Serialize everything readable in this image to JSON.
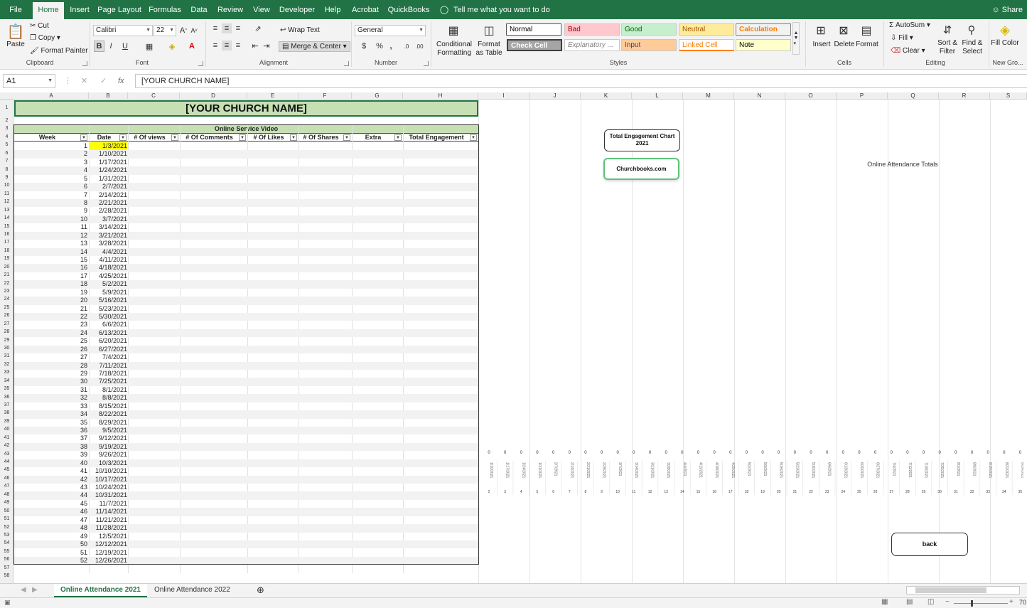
{
  "menu": {
    "tabs": [
      "File",
      "Home",
      "Insert",
      "Page Layout",
      "Formulas",
      "Data",
      "Review",
      "View",
      "Developer",
      "Help",
      "Acrobat",
      "QuickBooks"
    ],
    "active_tab": "Home",
    "tell_me": "Tell me what you want to do",
    "share": "Share"
  },
  "ribbon": {
    "clipboard": {
      "paste": "Paste",
      "cut": "Cut",
      "copy": "Copy",
      "format_painter": "Format Painter",
      "label": "Clipboard"
    },
    "font": {
      "name": "Calibri",
      "size": "22",
      "label": "Font"
    },
    "alignment": {
      "wrap": "Wrap Text",
      "merge": "Merge & Center",
      "label": "Alignment"
    },
    "number": {
      "format": "General",
      "currency": "$",
      "percent": "%",
      "comma": ",",
      "label": "Number"
    },
    "styles": {
      "conditional": "Conditional Formatting",
      "format_as_table": "Format as Table",
      "cells": [
        {
          "name": "Normal",
          "bg": "#ffffff",
          "fg": "#000000"
        },
        {
          "name": "Bad",
          "bg": "#ffc7ce",
          "fg": "#9c0006"
        },
        {
          "name": "Good",
          "bg": "#c6efce",
          "fg": "#006100"
        },
        {
          "name": "Neutral",
          "bg": "#ffeb9c",
          "fg": "#9c5700"
        },
        {
          "name": "Calculation",
          "bg": "#f2f2f2",
          "fg": "#fa7d00"
        },
        {
          "name": "Check Cell",
          "bg": "#a5a5a5",
          "fg": "#ffffff"
        },
        {
          "name": "Explanatory ...",
          "bg": "#ffffff",
          "fg": "#7f7f7f"
        },
        {
          "name": "Input",
          "bg": "#ffcc99",
          "fg": "#3f3f76"
        },
        {
          "name": "Linked Cell",
          "bg": "#ffffff",
          "fg": "#fa7d00"
        },
        {
          "name": "Note",
          "bg": "#ffffcc",
          "fg": "#000000"
        }
      ],
      "label": "Styles"
    },
    "cells": {
      "insert": "Insert",
      "delete": "Delete",
      "format": "Format",
      "label": "Cells"
    },
    "editing": {
      "autosum": "AutoSum",
      "fill": "Fill",
      "clear": "Clear",
      "sort": "Sort & Filter",
      "find": "Find & Select",
      "label": "Editing"
    },
    "newgroup": {
      "fill_color": "Fill Color",
      "label": "New Gro..."
    }
  },
  "formula_bar": {
    "name_box": "A1",
    "content": "[YOUR CHURCH NAME]"
  },
  "columns": [
    "A",
    "B",
    "C",
    "D",
    "E",
    "F",
    "G",
    "H",
    "I",
    "J",
    "K",
    "L",
    "M",
    "N",
    "O",
    "P",
    "Q",
    "R",
    "S"
  ],
  "sheet": {
    "title": "[YOUR CHURCH NAME]",
    "subtitle": "Online Service Video",
    "headers": [
      "Week",
      "Date",
      "# Of views",
      "# Of Comments",
      "# Of Likes",
      "# Of Shares",
      "Extra",
      "Total Engagement"
    ],
    "rows": [
      {
        "week": "1",
        "date": "1/3/2021"
      },
      {
        "week": "2",
        "date": "1/10/2021"
      },
      {
        "week": "3",
        "date": "1/17/2021"
      },
      {
        "week": "4",
        "date": "1/24/2021"
      },
      {
        "week": "5",
        "date": "1/31/2021"
      },
      {
        "week": "6",
        "date": "2/7/2021"
      },
      {
        "week": "7",
        "date": "2/14/2021"
      },
      {
        "week": "8",
        "date": "2/21/2021"
      },
      {
        "week": "9",
        "date": "2/28/2021"
      },
      {
        "week": "10",
        "date": "3/7/2021"
      },
      {
        "week": "11",
        "date": "3/14/2021"
      },
      {
        "week": "12",
        "date": "3/21/2021"
      },
      {
        "week": "13",
        "date": "3/28/2021"
      },
      {
        "week": "14",
        "date": "4/4/2021"
      },
      {
        "week": "15",
        "date": "4/11/2021"
      },
      {
        "week": "16",
        "date": "4/18/2021"
      },
      {
        "week": "17",
        "date": "4/25/2021"
      },
      {
        "week": "18",
        "date": "5/2/2021"
      },
      {
        "week": "19",
        "date": "5/9/2021"
      },
      {
        "week": "20",
        "date": "5/16/2021"
      },
      {
        "week": "21",
        "date": "5/23/2021"
      },
      {
        "week": "22",
        "date": "5/30/2021"
      },
      {
        "week": "23",
        "date": "6/6/2021"
      },
      {
        "week": "24",
        "date": "6/13/2021"
      },
      {
        "week": "25",
        "date": "6/20/2021"
      },
      {
        "week": "26",
        "date": "6/27/2021"
      },
      {
        "week": "27",
        "date": "7/4/2021"
      },
      {
        "week": "28",
        "date": "7/11/2021"
      },
      {
        "week": "29",
        "date": "7/18/2021"
      },
      {
        "week": "30",
        "date": "7/25/2021"
      },
      {
        "week": "31",
        "date": "8/1/2021"
      },
      {
        "week": "32",
        "date": "8/8/2021"
      },
      {
        "week": "33",
        "date": "8/15/2021"
      },
      {
        "week": "34",
        "date": "8/22/2021"
      },
      {
        "week": "35",
        "date": "8/29/2021"
      },
      {
        "week": "36",
        "date": "9/5/2021"
      },
      {
        "week": "37",
        "date": "9/12/2021"
      },
      {
        "week": "38",
        "date": "9/19/2021"
      },
      {
        "week": "39",
        "date": "9/26/2021"
      },
      {
        "week": "40",
        "date": "10/3/2021"
      },
      {
        "week": "41",
        "date": "10/10/2021"
      },
      {
        "week": "42",
        "date": "10/17/2021"
      },
      {
        "week": "43",
        "date": "10/24/2021"
      },
      {
        "week": "44",
        "date": "10/31/2021"
      },
      {
        "week": "45",
        "date": "11/7/2021"
      },
      {
        "week": "46",
        "date": "11/14/2021"
      },
      {
        "week": "47",
        "date": "11/21/2021"
      },
      {
        "week": "48",
        "date": "11/28/2021"
      },
      {
        "week": "49",
        "date": "12/5/2021"
      },
      {
        "week": "50",
        "date": "12/12/2021"
      },
      {
        "week": "51",
        "date": "12/19/2021"
      },
      {
        "week": "52",
        "date": "12/26/2021"
      }
    ]
  },
  "shapes": {
    "chart_title": "Total Engagement Chart 2021",
    "churchbooks": "Churchbooks.com",
    "back": "back",
    "chart_caption": "Online Attendance Totals"
  },
  "chart_data": {
    "type": "bar",
    "title": "Online Attendance Totals",
    "categories": [
      "1/10/2021",
      "1/17/2021",
      "1/24/2021",
      "1/31/2021",
      "2/7/2021",
      "2/14/2021",
      "2/21/2021",
      "2/28/2021",
      "3/7/2021",
      "3/14/2021",
      "3/21/2021",
      "3/28/2021",
      "4/4/2021",
      "4/11/2021",
      "4/18/2021",
      "4/25/2021",
      "5/2/2021",
      "5/9/2021",
      "5/16/2021",
      "5/23/2021",
      "5/30/2021",
      "6/6/2021",
      "6/13/2021",
      "6/20/2021",
      "6/27/2021",
      "7/4/2021",
      "7/11/2021",
      "7/18/2021",
      "7/25/2021",
      "8/1/2021",
      "8/8/2021",
      "8/15/2021",
      "8/22/2021",
      "8/29/2021"
    ],
    "weeks": [
      "2",
      "3",
      "4",
      "5",
      "6",
      "7",
      "8",
      "9",
      "10",
      "11",
      "12",
      "13",
      "14",
      "15",
      "16",
      "17",
      "18",
      "19",
      "20",
      "21",
      "22",
      "23",
      "24",
      "25",
      "26",
      "27",
      "28",
      "29",
      "30",
      "31",
      "32",
      "33",
      "34",
      "35"
    ],
    "values": [
      0,
      0,
      0,
      0,
      0,
      0,
      0,
      0,
      0,
      0,
      0,
      0,
      0,
      0,
      0,
      0,
      0,
      0,
      0,
      0,
      0,
      0,
      0,
      0,
      0,
      0,
      0,
      0,
      0,
      0,
      0,
      0,
      0,
      0
    ],
    "ylim": [
      0,
      1
    ]
  },
  "sheet_tabs": [
    "Online Attendance 2021",
    "Online Attendance 2022"
  ],
  "status": {
    "zoom": "70"
  }
}
